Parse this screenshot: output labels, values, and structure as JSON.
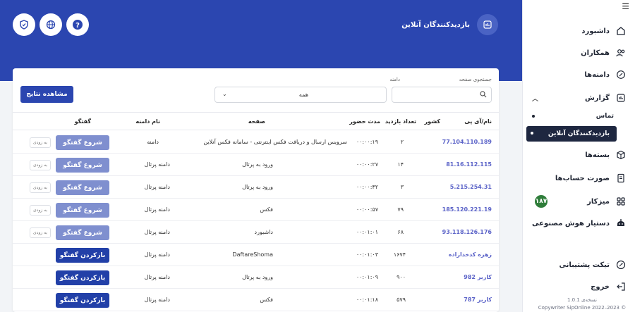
{
  "header": {
    "title": "بازدیدکنندگان آنلاین",
    "icons": [
      "shield-icon",
      "globe-icon",
      "help-icon"
    ]
  },
  "sidebar": {
    "items": [
      {
        "label": "داشبورد",
        "icon": "home-icon"
      },
      {
        "label": "همکاران",
        "icon": "users-icon"
      },
      {
        "label": "دامنه‌ها",
        "icon": "domain-icon"
      },
      {
        "label": "گزارش",
        "icon": "report-icon"
      },
      {
        "label": "بسته‌ها",
        "icon": "box-icon"
      },
      {
        "label": "صورت حساب‌ها",
        "icon": "invoice-icon"
      },
      {
        "label": "میزکار",
        "icon": "grid-icon",
        "badge": "۱۸۷"
      },
      {
        "label": "دستیار هوش مصنوعی",
        "icon": "ai-icon"
      },
      {
        "label": "تیکت پشتیبانی",
        "icon": "ticket-icon"
      },
      {
        "label": "خروج",
        "icon": "logout-icon"
      }
    ],
    "report_sub": [
      {
        "label": "تماس"
      },
      {
        "label": "بازدیدکنندگان آنلاین"
      }
    ],
    "version": "نسخه‌ی 1.0.1",
    "copyright": "Copywriter SipOnline 2022–2023 ©"
  },
  "filters": {
    "search_label": "جستجوی صفحه",
    "search_value": "",
    "domain_label": "دامنه",
    "domain_value": "همه",
    "view_button": "مشاهده نتایج"
  },
  "table": {
    "headers": {
      "ip": "نام/آی پی",
      "country": "کشور",
      "visits": "تعداد بازدید",
      "duration": "مدت حضور",
      "page": "صفحه",
      "domain": "نام دامنه",
      "chat": "گفتگو"
    },
    "soon_label": "به زودی",
    "rows": [
      {
        "ip": "77.104.110.189",
        "country": "",
        "visits": "۲",
        "duration": "۰۰:۰۰:۱۹",
        "page": "سرویس ارسال و دریافت فکس اینترنتی - سامانه فکس آنلاین",
        "domain": "دامنه",
        "chat": "شروع گفتگو",
        "type": "start"
      },
      {
        "ip": "81.16.112.115",
        "country": "",
        "visits": "۱۴",
        "duration": "۰۰:۰۰:۲۷",
        "page": "ورود به پرتال",
        "domain": "دامنه پرتال",
        "chat": "شروع گفتگو",
        "type": "start"
      },
      {
        "ip": "5.215.254.31",
        "country": "",
        "visits": "۳",
        "duration": "۰۰:۰۰:۴۲",
        "page": "ورود به پرتال",
        "domain": "دامنه پرتال",
        "chat": "شروع گفتگو",
        "type": "start"
      },
      {
        "ip": "185.120.221.19",
        "country": "",
        "visits": "۷۹",
        "duration": "۰۰:۰۰:۵۷",
        "page": "فکس",
        "domain": "دامنه پرتال",
        "chat": "شروع گفتگو",
        "type": "start"
      },
      {
        "ip": "93.118.126.176",
        "country": "",
        "visits": "۶۸",
        "duration": "۰۰:۰۱:۰۱",
        "page": "داشبورد",
        "domain": "دامنه پرتال",
        "chat": "شروع گفتگو",
        "type": "start"
      },
      {
        "ip": "زهره کدخدازاده",
        "country": "",
        "visits": "۱۶۷۴",
        "duration": "۰۰:۰۱:۰۳",
        "page": "DaftareShoma",
        "domain": "دامنه پرتال",
        "chat": "بازکردن گفتگو",
        "type": "reopen"
      },
      {
        "ip": "کاربر 982",
        "country": "",
        "visits": "۹۰۰",
        "duration": "۰۰:۰۱:۰۹",
        "page": "ورود به پرتال",
        "domain": "دامنه پرتال",
        "chat": "بازکردن گفتگو",
        "type": "reopen"
      },
      {
        "ip": "کاربر 787",
        "country": "",
        "visits": "۵۷۹",
        "duration": "۰۰:۰۱:۱۸",
        "page": "فکس",
        "domain": "دامنه پرتال",
        "chat": "بازکردن گفتگو",
        "type": "reopen"
      }
    ]
  },
  "colors": {
    "header_bg": "#2b46b0",
    "active_item_bg": "#1e2740",
    "start_chat": "#7f8fcf",
    "reopen_chat": "#2240a8",
    "badge": "#2f7d3a"
  }
}
